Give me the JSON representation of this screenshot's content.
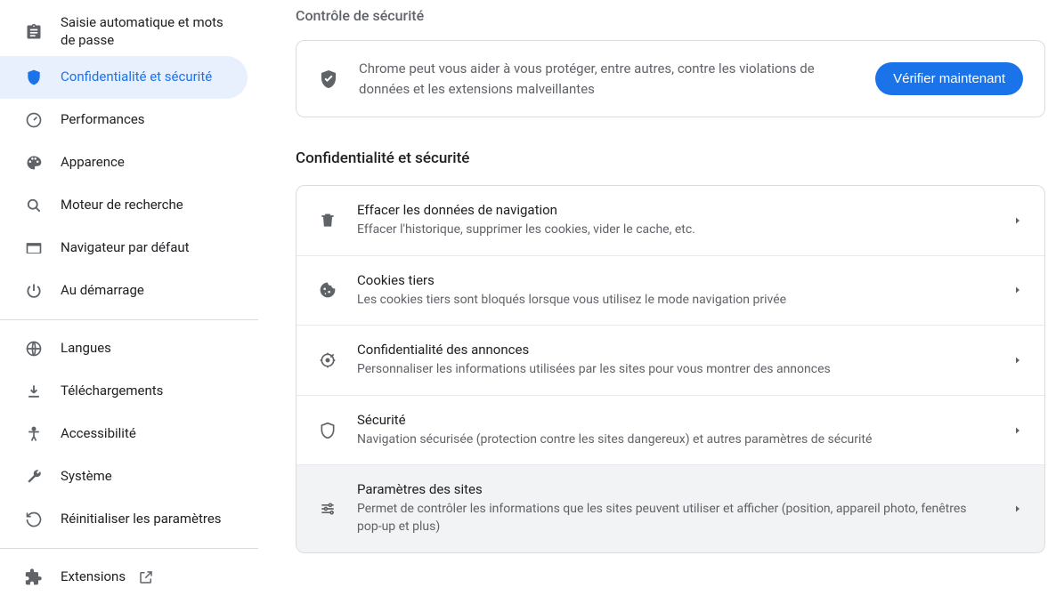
{
  "sidebar": {
    "items": [
      {
        "label": "Saisie automatique et mots de passe"
      },
      {
        "label": "Confidentialité et sécurité"
      },
      {
        "label": "Performances"
      },
      {
        "label": "Apparence"
      },
      {
        "label": "Moteur de recherche"
      },
      {
        "label": "Navigateur par défaut"
      },
      {
        "label": "Au démarrage"
      },
      {
        "label": "Langues"
      },
      {
        "label": "Téléchargements"
      },
      {
        "label": "Accessibilité"
      },
      {
        "label": "Système"
      },
      {
        "label": "Réinitialiser les paramètres"
      },
      {
        "label": "Extensions"
      }
    ]
  },
  "sections": {
    "security_check_title": "Contrôle de sécurité",
    "security_check_text": "Chrome peut vous aider à vous protéger, entre autres, contre les violations de données et les extensions malveillantes",
    "security_check_button": "Vérifier maintenant",
    "privacy_title": "Confidentialité et sécurité"
  },
  "privacy_rows": [
    {
      "title": "Effacer les données de navigation",
      "sub": "Effacer l'historique, supprimer les cookies, vider le cache, etc."
    },
    {
      "title": "Cookies tiers",
      "sub": "Les cookies tiers sont bloqués lorsque vous utilisez le mode navigation privée"
    },
    {
      "title": "Confidentialité des annonces",
      "sub": "Personnaliser les informations utilisées par les sites pour vous montrer des annonces"
    },
    {
      "title": "Sécurité",
      "sub": "Navigation sécurisée (protection contre les sites dangereux) et autres paramètres de sécurité"
    },
    {
      "title": "Paramètres des sites",
      "sub": "Permet de contrôler les informations que les sites peuvent utiliser et afficher (position, appareil photo, fenêtres pop-up et plus)"
    }
  ]
}
